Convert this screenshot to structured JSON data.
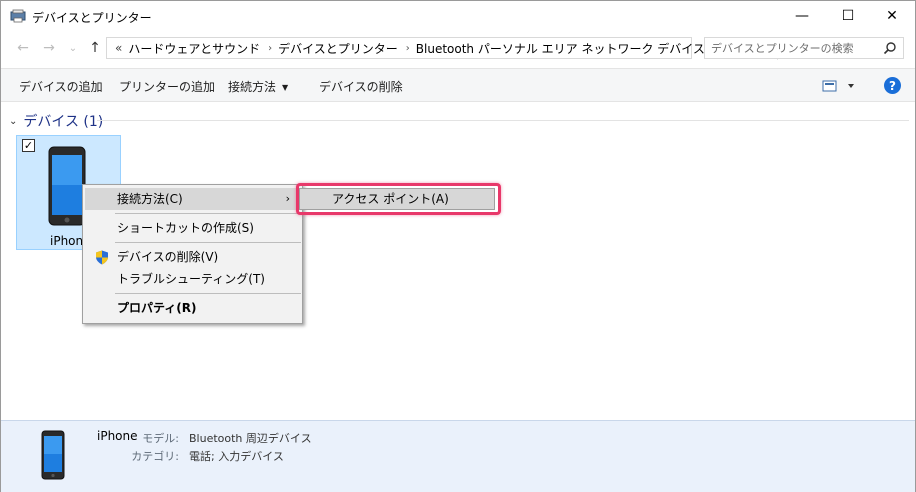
{
  "window": {
    "title": "デバイスとプリンター",
    "minimize": "—",
    "maximize": "☐",
    "close": "✕"
  },
  "address": {
    "back": "←",
    "forward": "→",
    "recent": "⌄",
    "up": "↑",
    "overflow": "«",
    "crumbs": [
      "ハードウェアとサウンド",
      "デバイスとプリンター",
      "Bluetooth パーソナル エリア ネットワーク デバイス"
    ],
    "sep": "›",
    "dropdown": "⌄",
    "refresh": "↻",
    "search_placeholder": "デバイスとプリンターの検索"
  },
  "toolbar": {
    "add_device": "デバイスの追加",
    "add_printer": "プリンターの追加",
    "connect_using": "接続方法",
    "caret": "▼",
    "remove_device": "デバイスの削除",
    "help": "?"
  },
  "group": {
    "chevron": "⌄",
    "title": "デバイス (1)"
  },
  "device": {
    "name": "iPhone",
    "check": "✓"
  },
  "context_menu": {
    "items": [
      {
        "label": "接続方法(C)",
        "arrow": "›"
      },
      {
        "label": "ショートカットの作成(S)"
      },
      {
        "label": "デバイスの削除(V)"
      },
      {
        "label": "トラブルシューティング(T)"
      },
      {
        "label": "プロパティ(R)"
      }
    ]
  },
  "submenu": {
    "item": "アクセス ポイント(A)"
  },
  "details": {
    "name": "iPhone",
    "model_label": "モデル:",
    "model_value": "Bluetooth 周辺デバイス",
    "category_label": "カテゴリ:",
    "category_value": "電話; 入力デバイス"
  },
  "colors": {
    "highlight_outline": "#e8386a",
    "help_blue": "#1a6ed8",
    "selection": "#cce8ff"
  }
}
